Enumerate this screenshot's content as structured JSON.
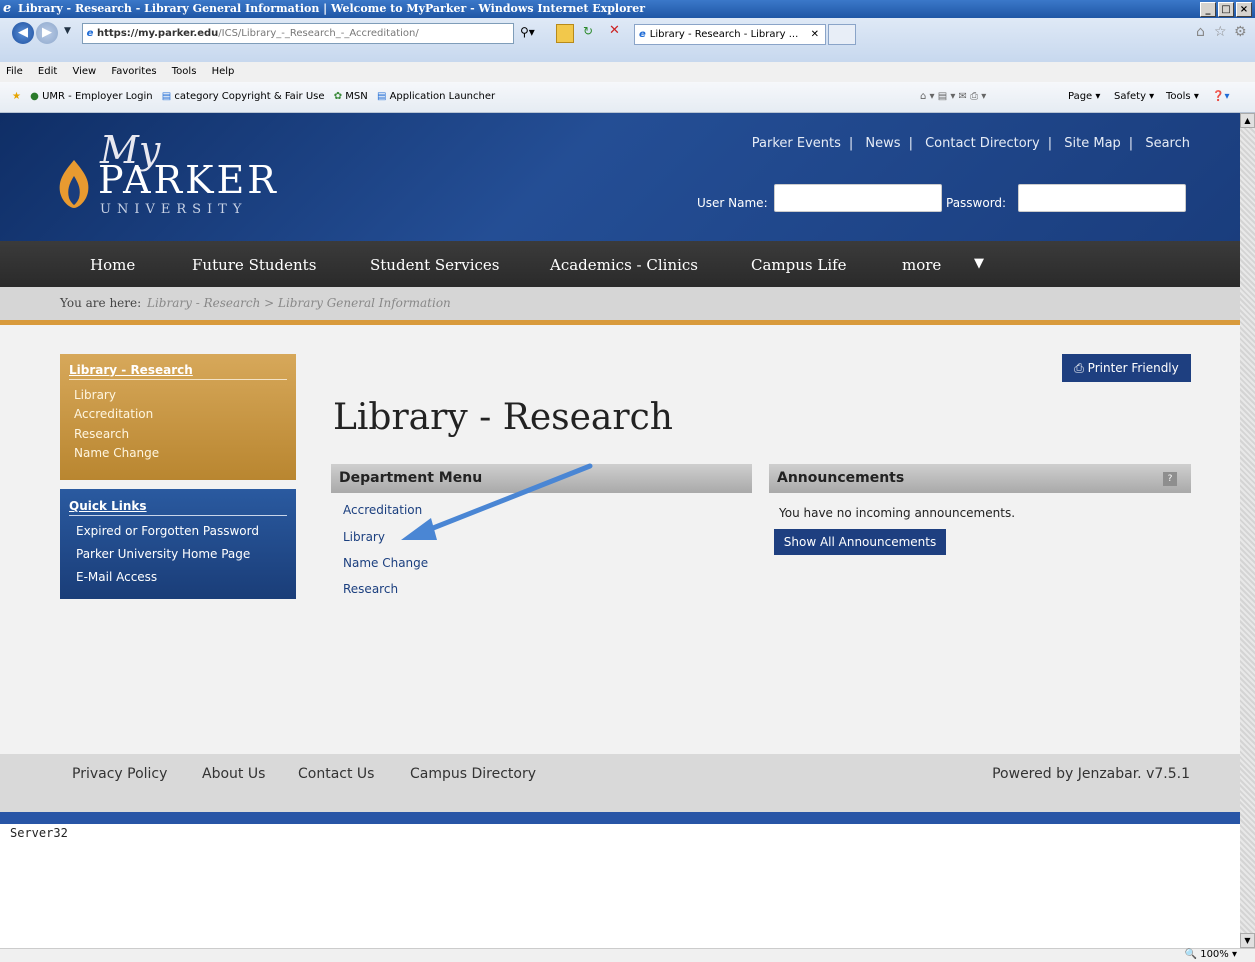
{
  "window": {
    "title": "Library - Research - Library General Information | Welcome to MyParker - Windows Internet Explorer",
    "controls": [
      "_",
      "□",
      "×"
    ]
  },
  "browser": {
    "url_domain": "https://my.parker.edu",
    "url_path": "/ICS/Library_-_Research_-_Accreditation/",
    "tab_label": "Library - Research - Library ...",
    "menu": [
      "File",
      "Edit",
      "View",
      "Favorites",
      "Tools",
      "Help"
    ],
    "favorites": [
      "UMR - Employer Login",
      "category Copyright & Fair Use",
      "MSN",
      "Application Launcher"
    ],
    "command_bar": [
      "Page ▾",
      "Safety ▾",
      "Tools ▾"
    ],
    "zoom": "100%"
  },
  "site": {
    "logo": {
      "my": "My",
      "parker": "PARKER",
      "university": "UNIVERSITY"
    },
    "top_links": [
      "Parker Events",
      "News",
      "Contact Directory",
      "Site Map",
      "Search"
    ],
    "login": {
      "user_label": "User Name:",
      "password_label": "Password:"
    },
    "nav": [
      "Home",
      "Future Students",
      "Student Services",
      "Academics - Clinics",
      "Campus Life",
      "more"
    ],
    "breadcrumb_label": "You are here:",
    "breadcrumb_path": "Library - Research > Library General Information"
  },
  "sidebar": {
    "library_header": "Library - Research",
    "library_items": [
      "Library",
      "Accreditation",
      "Research",
      "Name Change"
    ],
    "quick_header": "Quick Links",
    "quick_items": [
      "Expired or Forgotten Password",
      "Parker University Home Page",
      "E-Mail Access"
    ]
  },
  "main": {
    "title": "Library - Research",
    "print_label": "Printer Friendly",
    "dept_menu_title": "Department Menu",
    "dept_links": [
      "Accreditation",
      "Library",
      "Name Change",
      "Research"
    ],
    "announcements_title": "Announcements",
    "announcements_help": "?",
    "announcements_msg": "You have no incoming announcements.",
    "show_all": "Show All Announcements"
  },
  "footer": {
    "links": [
      "Privacy Policy",
      "About Us",
      "Contact Us",
      "Campus Directory"
    ],
    "powered": "Powered by Jenzabar. v7.5.1"
  },
  "server": "Server32",
  "colors": {
    "header": "#244e95",
    "accent": "#d89a3c",
    "button": "#1e3f80",
    "arrow": "#4a86d4"
  }
}
